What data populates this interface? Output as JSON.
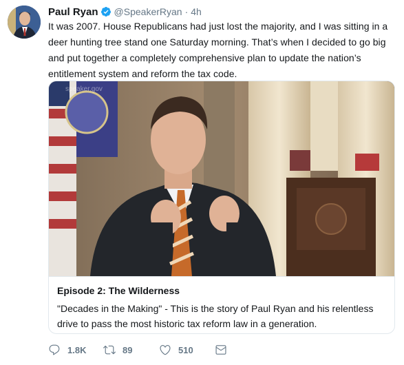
{
  "tweet": {
    "author_name": "Paul Ryan",
    "handle": "@SpeakerRyan",
    "separator": "·",
    "time": "4h",
    "text": "It was 2007. House Republicans had just lost the majority, and I was sitting in a deer hunting tree stand one Saturday morning. That’s when I decided to go big and put together a completely comprehensive plan to update the nation’s entitlement system and reform the tax code."
  },
  "card": {
    "watermark": "speaker.gov",
    "title": "Episode 2: The Wilderness",
    "description": "\"Decades in the Making\" - This is the story of Paul Ryan and his relentless drive to pass the most historic tax reform law in a generation."
  },
  "actions": {
    "reply_count": "1.8K",
    "retweet_count": "89",
    "like_count": "510"
  },
  "colors": {
    "verified": "#1da1f2",
    "muted": "#657786",
    "border": "#e1e8ed"
  },
  "icons": {
    "avatar": "avatar",
    "verified": "verified-badge-icon",
    "reply": "reply-icon",
    "retweet": "retweet-icon",
    "like": "heart-icon",
    "dm": "envelope-icon"
  }
}
